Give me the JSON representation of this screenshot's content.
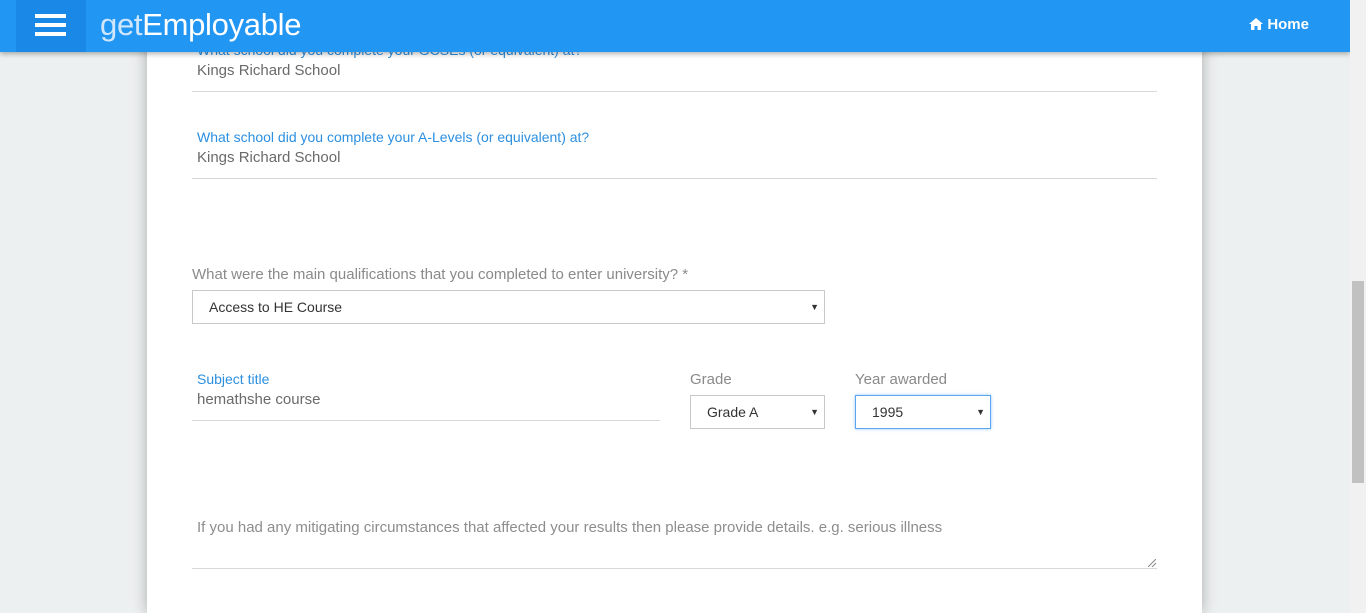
{
  "header": {
    "brand_prefix": "get",
    "brand_main": "Employable",
    "home_label": "Home",
    "menu_icon": "hamburger-icon",
    "home_icon": "home-icon"
  },
  "form": {
    "gcse_school": {
      "label": "What school did you complete your GCSEs (or equivalent) at?",
      "value": "Kings Richard School"
    },
    "alevel_school": {
      "label": "What school did you complete your A-Levels (or equivalent) at?",
      "value": "Kings Richard School"
    },
    "qualifications": {
      "label": "What were the main qualifications that you completed to enter university? *",
      "selected": "Access to HE Course"
    },
    "subject": {
      "label": "Subject title",
      "value": "hemathshe course"
    },
    "grade": {
      "label": "Grade",
      "selected": "Grade A"
    },
    "year": {
      "label": "Year awarded",
      "selected": "1995"
    },
    "mitigating": {
      "placeholder": "If you had any mitigating circumstances that affected your results then please provide details. e.g. serious illness"
    }
  },
  "colors": {
    "header": "#2196f3",
    "accent_label": "#2c8fe0",
    "page_bg": "#edf0f0"
  }
}
